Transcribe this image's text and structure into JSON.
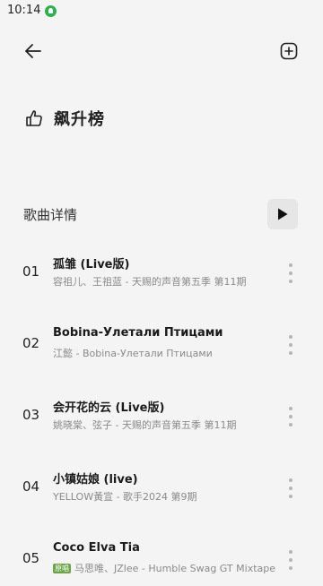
{
  "status": {
    "time": "10:14"
  },
  "header": {
    "back_icon": "arrow-left-icon",
    "add_icon": "plus-square-icon"
  },
  "hero": {
    "title": "飙升榜",
    "icon": "thumbs-up-outline-icon"
  },
  "section": {
    "title": "歌曲详情",
    "play_icon": "play-icon"
  },
  "songs": [
    {
      "rank": "01",
      "title": "孤雏 (Live版)",
      "meta": "容祖儿、王祖蓝 - 天赐的声音第五季 第11期",
      "badge": ""
    },
    {
      "rank": "02",
      "title": "Bobina-Улетали Птицами",
      "meta": "江懿 - Bobina-Улетали Птицами",
      "badge": ""
    },
    {
      "rank": "03",
      "title": "会开花的云 (Live版)",
      "meta": "姚晓棠、弦子 - 天赐的声音第五季 第11期",
      "badge": ""
    },
    {
      "rank": "04",
      "title": "小镇姑娘 (live)",
      "meta": "YELLOW黃宣 - 歌手2024 第9期",
      "badge": ""
    },
    {
      "rank": "05",
      "title": "Coco Elva Tia",
      "meta": "马思唯、JZlee - Humble Swag GT Mixtape",
      "badge": "原唱"
    }
  ],
  "colors": {
    "background": "#f4f4f4",
    "status_dot": "#2bb24c",
    "meta_text": "#8a8a8a"
  }
}
